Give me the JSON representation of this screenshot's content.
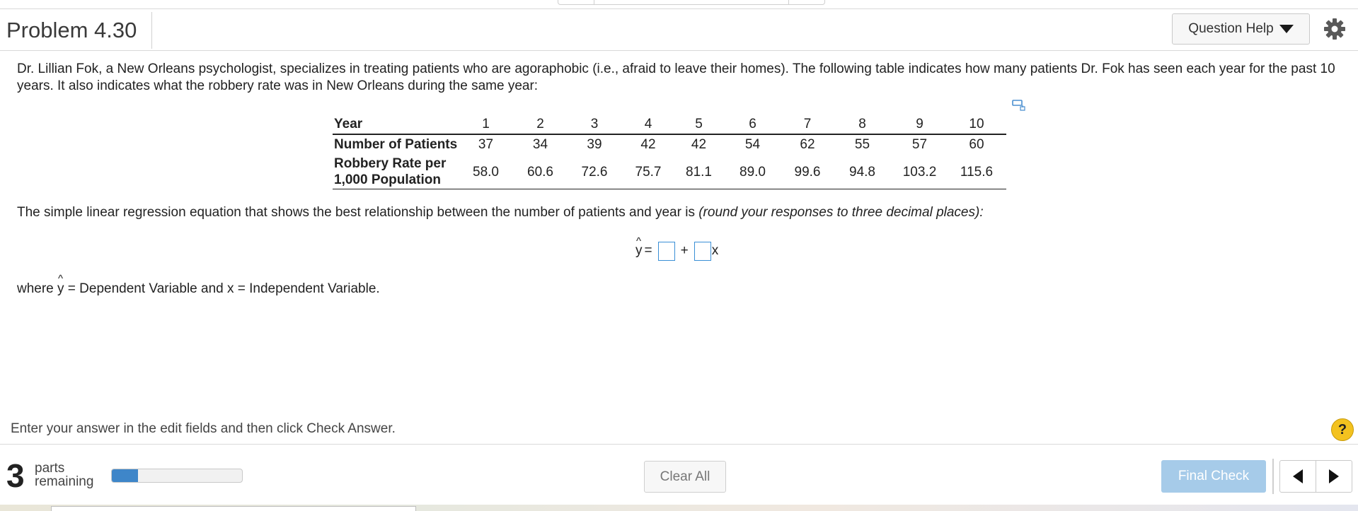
{
  "header": {
    "title": "Problem 4.30",
    "help_label": "Question Help"
  },
  "intro": {
    "text": "Dr. Lillian Fok, a New Orleans psychologist, specializes in treating patients who are agoraphobic (i.e., afraid to leave their homes). The following table indicates how many patients Dr. Fok has seen each year for the past 10 years. It also indicates what the robbery rate was in New Orleans during the same year:"
  },
  "table": {
    "row_labels": {
      "year": "Year",
      "patients": "Number of Patients",
      "robbery_line1": "Robbery Rate per",
      "robbery_line2": "1,000 Population"
    },
    "years": [
      "1",
      "2",
      "3",
      "4",
      "5",
      "6",
      "7",
      "8",
      "9",
      "10"
    ],
    "patients": [
      "37",
      "34",
      "39",
      "42",
      "42",
      "54",
      "62",
      "55",
      "57",
      "60"
    ],
    "robbery": [
      "58.0",
      "60.6",
      "72.6",
      "75.7",
      "81.1",
      "89.0",
      "99.6",
      "94.8",
      "103.2",
      "115.6"
    ]
  },
  "question": {
    "main": "The simple linear regression equation that shows the best relationship between the number of patients and year is ",
    "instruction": "(round your responses to three decimal places):"
  },
  "equation": {
    "y": "y",
    "hat": "^",
    "equals": "=",
    "plus": "+",
    "x": "x",
    "intercept_value": "",
    "slope_value": ""
  },
  "where": {
    "prefix": "where ",
    "y": "y",
    "hat": "^",
    "suffix": " = Dependent Variable and x = Independent Variable."
  },
  "footer": {
    "enter_text": "Enter your answer in the edit fields and then click Check Answer.",
    "help_symbol": "?",
    "parts_count": "3",
    "parts_line1": "parts",
    "parts_line2": "remaining",
    "progress_fraction": 0.2,
    "clear_label": "Clear All",
    "final_label": "Final Check"
  },
  "colors": {
    "progress_fill": "#3e86c9",
    "final_button": "#a6cbe9",
    "input_border": "#3a8fd6",
    "help_badge": "#f3c21f"
  },
  "icons": {
    "settings": "gear-icon",
    "dropdown": "caret-down-icon",
    "table_popout": "popout-icon",
    "prev": "arrow-left-icon",
    "next": "arrow-right-icon"
  }
}
